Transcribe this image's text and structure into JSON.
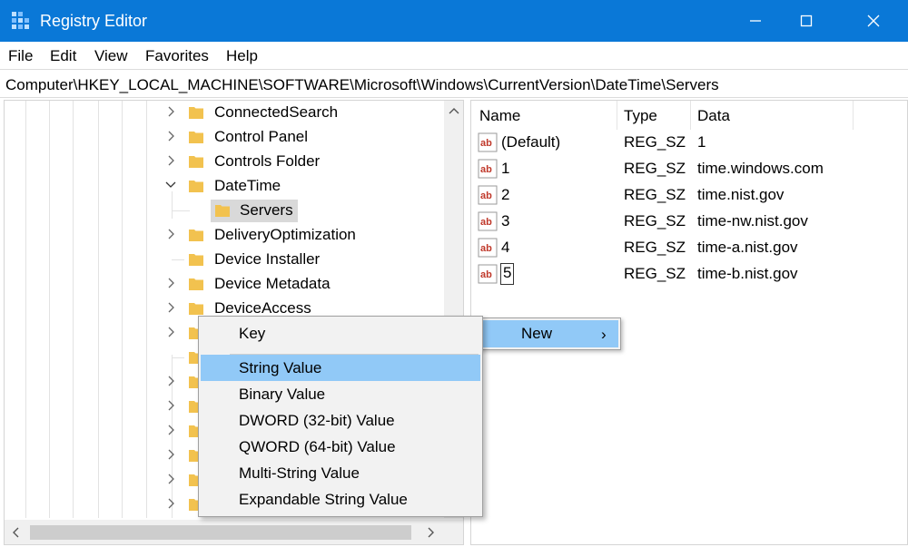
{
  "window": {
    "title": "Registry Editor"
  },
  "menu": [
    "File",
    "Edit",
    "View",
    "Favorites",
    "Help"
  ],
  "address": {
    "path": "Computer\\HKEY_LOCAL_MACHINE\\SOFTWARE\\Microsoft\\Windows\\CurrentVersion\\DateTime\\Servers"
  },
  "tree": [
    {
      "label": "ConnectedSearch",
      "state": "collapsed"
    },
    {
      "label": "Control Panel",
      "state": "collapsed"
    },
    {
      "label": "Controls Folder",
      "state": "collapsed"
    },
    {
      "label": "DateTime",
      "state": "expanded"
    },
    {
      "label": "Servers",
      "state": "selected-child"
    },
    {
      "label": "DeliveryOptimization",
      "state": "collapsed"
    },
    {
      "label": "Device Installer",
      "state": "leaf"
    },
    {
      "label": "Device Metadata",
      "state": "collapsed"
    },
    {
      "label": "DeviceAccess",
      "state": "collapsed"
    }
  ],
  "values_table": {
    "headers": {
      "name": "Name",
      "type": "Type",
      "data": "Data"
    },
    "rows": [
      {
        "name": "(Default)",
        "type": "REG_SZ",
        "data": "1"
      },
      {
        "name": "1",
        "type": "REG_SZ",
        "data": "time.windows.com"
      },
      {
        "name": "2",
        "type": "REG_SZ",
        "data": "time.nist.gov"
      },
      {
        "name": "3",
        "type": "REG_SZ",
        "data": "time-nw.nist.gov"
      },
      {
        "name": "4",
        "type": "REG_SZ",
        "data": "time-a.nist.gov"
      },
      {
        "name": "5",
        "type": "REG_SZ",
        "data": "time-b.nist.gov"
      }
    ]
  },
  "context_menu": {
    "new_label": "New",
    "arrow": "›"
  },
  "submenu": {
    "items": [
      "Key",
      "String Value",
      "Binary Value",
      "DWORD (32-bit) Value",
      "QWORD (64-bit) Value",
      "Multi-String Value",
      "Expandable String Value"
    ],
    "highlighted": "String Value"
  },
  "colors": {
    "titlebar": "#0a78d7",
    "menu_highlight": "#91c9f7",
    "folder": "#f2c24f"
  },
  "icons": [
    "registry-icon",
    "minimize-icon",
    "maximize-icon",
    "close-icon",
    "chevron-right-icon",
    "chevron-down-icon",
    "folder-icon",
    "string-value-icon"
  ]
}
